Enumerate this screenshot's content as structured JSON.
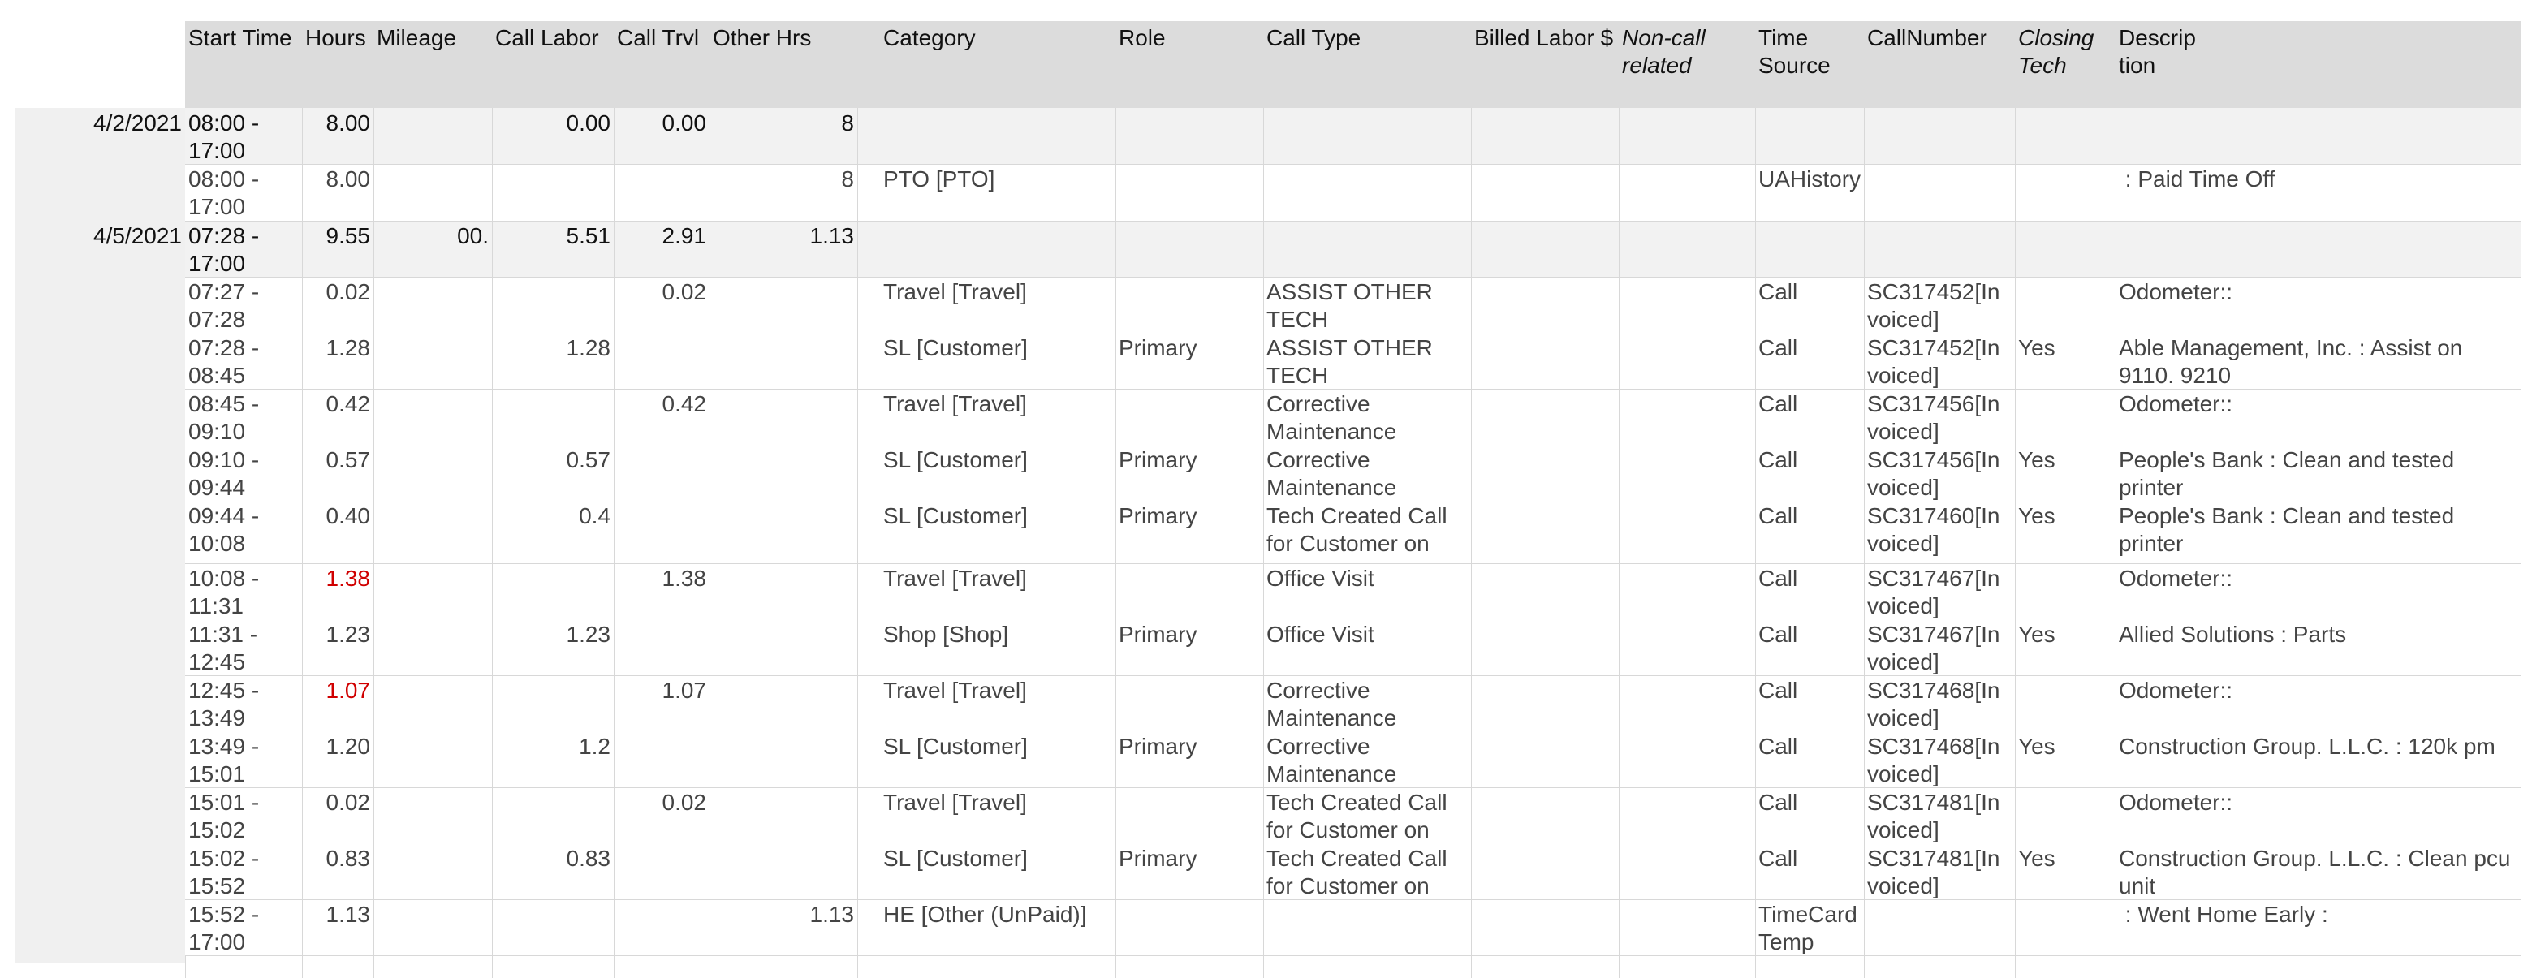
{
  "columns": [
    {
      "key": "start_time",
      "label": "Start Time"
    },
    {
      "key": "hours",
      "label": "Hours"
    },
    {
      "key": "mileage",
      "label": "Mileage"
    },
    {
      "key": "call_labor",
      "label": "Call Labor"
    },
    {
      "key": "call_trvl",
      "label": "Call Trvl"
    },
    {
      "key": "other_hrs",
      "label": "Other Hrs"
    },
    {
      "key": "category",
      "label": "Category"
    },
    {
      "key": "role",
      "label": "Role"
    },
    {
      "key": "call_type",
      "label": "Call Type"
    },
    {
      "key": "billed_labor",
      "label": "Billed Labor $"
    },
    {
      "key": "non_call",
      "label": "Non-call\nrelated",
      "italic": true
    },
    {
      "key": "time_source",
      "label": "Time\nSource"
    },
    {
      "key": "call_number",
      "label": "CallNumber"
    },
    {
      "key": "closing_tech",
      "label": "Closing\nTech",
      "italic": true
    },
    {
      "key": "description",
      "label": "Descrip\ntion"
    }
  ],
  "rows": [
    {
      "kind": "summary",
      "date": "4/2/2021",
      "start_time": "08:00 -\n17:00",
      "hours": "8.00",
      "mileage": "",
      "call_labor": "0.00",
      "call_trvl": "0.00",
      "other_hrs": "8"
    },
    {
      "kind": "detail",
      "start_time": "08:00 -\n17:00",
      "hours": "8.00",
      "other_hrs": "8",
      "category": "PTO [PTO]",
      "time_source": "UAHistory",
      "description": " : Paid Time Off"
    },
    {
      "kind": "summary",
      "date": "4/5/2021",
      "start_time": "07:28 -\n17:00",
      "hours": "9.55",
      "mileage": "00.",
      "call_labor": "5.51",
      "call_trvl": "2.91",
      "other_hrs": "1.13"
    },
    {
      "kind": "detail",
      "start_time": "07:27 -\n07:28",
      "hours": "0.02",
      "call_trvl": "0.02",
      "category": "Travel [Travel]",
      "call_type": "ASSIST OTHER\nTECH",
      "time_source": "Call",
      "call_number": "SC317452[In\nvoiced]",
      "description": "Odometer::"
    },
    {
      "kind": "detail",
      "start_time": "07:28 -\n08:45",
      "hours": "1.28",
      "call_labor": "1.28",
      "category": "SL [Customer]",
      "role": "Primary",
      "call_type": "ASSIST OTHER\nTECH",
      "time_source": "Call",
      "call_number": "SC317452[In\nvoiced]",
      "closing_tech": "Yes",
      "description": "Able Management, Inc. : Assist on\n9110. 9210"
    },
    {
      "kind": "detail",
      "start_time": "08:45 -\n09:10",
      "hours": "0.42",
      "call_trvl": "0.42",
      "category": "Travel [Travel]",
      "call_type": "Corrective\nMaintenance",
      "time_source": "Call",
      "call_number": "SC317456[In\nvoiced]",
      "description": "Odometer::"
    },
    {
      "kind": "detail",
      "start_time": "09:10 -\n09:44",
      "hours": "0.57",
      "call_labor": "0.57",
      "category": "SL [Customer]",
      "role": "Primary",
      "call_type": "Corrective\nMaintenance",
      "time_source": "Call",
      "call_number": "SC317456[In\nvoiced]",
      "closing_tech": "Yes",
      "description": "People's Bank : Clean and tested\nprinter"
    },
    {
      "kind": "detail",
      "start_time": "09:44 -\n10:08",
      "hours": "0.40",
      "call_labor": "0.4",
      "category": "SL [Customer]",
      "role": "Primary",
      "call_type": "Tech Created Call\nfor Customer on",
      "time_source": "Call",
      "call_number": "SC317460[In\nvoiced]",
      "closing_tech": "Yes",
      "description": "People's Bank : Clean and tested\nprinter"
    },
    {
      "kind": "detail",
      "start_time": "10:08 -\n11:31",
      "hours": "1.38",
      "hours_alert": true,
      "call_trvl": "1.38",
      "category": "Travel [Travel]",
      "call_type": "Office Visit",
      "time_source": "Call",
      "call_number": "SC317467[In\nvoiced]",
      "description": "Odometer::"
    },
    {
      "kind": "detail",
      "start_time": "11:31 -\n12:45",
      "hours": "1.23",
      "call_labor": "1.23",
      "category": "Shop [Shop]",
      "role": "Primary",
      "call_type": "Office Visit",
      "time_source": "Call",
      "call_number": "SC317467[In\nvoiced]",
      "closing_tech": "Yes",
      "description": "Allied Solutions : Parts"
    },
    {
      "kind": "detail",
      "start_time": "12:45 -\n13:49",
      "hours": "1.07",
      "hours_alert": true,
      "call_trvl": "1.07",
      "category": "Travel [Travel]",
      "call_type": "Corrective\nMaintenance",
      "time_source": "Call",
      "call_number": "SC317468[In\nvoiced]",
      "description": "Odometer::"
    },
    {
      "kind": "detail",
      "start_time": "13:49 -\n15:01",
      "hours": "1.20",
      "call_labor": "1.2",
      "category": "SL [Customer]",
      "role": "Primary",
      "call_type": "Corrective\nMaintenance",
      "time_source": "Call",
      "call_number": "SC317468[In\nvoiced]",
      "closing_tech": "Yes",
      "description": "Construction Group. L.L.C. : 120k pm"
    },
    {
      "kind": "detail",
      "start_time": "15:01 -\n15:02",
      "hours": "0.02",
      "call_trvl": "0.02",
      "category": "Travel [Travel]",
      "call_type": "Tech Created Call\nfor Customer on",
      "time_source": "Call",
      "call_number": "SC317481[In\nvoiced]",
      "description": "Odometer::"
    },
    {
      "kind": "detail",
      "start_time": "15:02 -\n15:52",
      "hours": "0.83",
      "call_labor": "0.83",
      "category": "SL [Customer]",
      "role": "Primary",
      "call_type": "Tech Created Call\nfor Customer on",
      "time_source": "Call",
      "call_number": "SC317481[In\nvoiced]",
      "closing_tech": "Yes",
      "description": "Construction Group. L.L.C. : Clean pcu\nunit"
    },
    {
      "kind": "detail",
      "start_time": "15:52 -\n17:00",
      "hours": "1.13",
      "other_hrs": "1.13",
      "category": "HE [Other (UnPaid)]",
      "time_source": "TimeCard\nTemp",
      "description": " : Went Home Early :"
    }
  ],
  "colors": {
    "header_bg": "#dcdcdc",
    "summary_bg": "#f2f2f2",
    "left_band": "#f0f0f0",
    "alert": "#d00000",
    "grid_line": "#d8d8d8"
  }
}
